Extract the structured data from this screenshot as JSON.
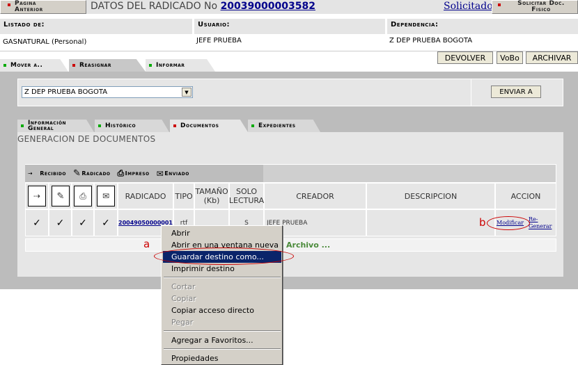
{
  "header": {
    "prev_page_line1": "Pagina",
    "prev_page_line2": "Anterior",
    "title_prefix": "DATOS DEL RADICADO No",
    "radicado_number": "20039000003582",
    "solicitados": "Solicitados",
    "solicitar_line1": "Solicitar Doc.",
    "solicitar_line2": "Fisico"
  },
  "info": {
    "listado_label": "Listado de:",
    "listado_value": "GASNATURAL (Personal)",
    "usuario_label": "Usuario:",
    "usuario_value": "JEFE PRUEBA",
    "dependencia_label": "Dependencia:",
    "dependencia_value": "Z DEP PRUEBA BOGOTA"
  },
  "actions": {
    "tab_mover": "Mover a..",
    "tab_reasignar": "Reasignar",
    "tab_informar": "Informar",
    "devolver": "DEVOLVER",
    "vobo": "VoBo",
    "archivar": "ARCHIVAR"
  },
  "reassign": {
    "selected": "Z DEP PRUEBA BOGOTA",
    "enviar": "ENVIAR A"
  },
  "tabs": {
    "info_line1": "Información",
    "info_line2": "General",
    "historico": "Histórico",
    "documentos": "Documentos",
    "expedientes": "Expedientes"
  },
  "section_title": "GENERACION DE DOCUMENTOS",
  "legend": {
    "recibido": "Recibido",
    "radicado": "Radicado",
    "impreso": "Impreso",
    "enviado": "Enviado"
  },
  "table": {
    "headers": {
      "radicado": "RADICADO",
      "tipo": "TIPO",
      "tamano_line1": "TAMAÑO",
      "tamano_line2": "(Kb)",
      "solo_line1": "SOLO",
      "solo_line2": "LECTURA",
      "creador": "CREADOR",
      "descripcion": "DESCRIPCION",
      "accion": "ACCION"
    },
    "row": {
      "checks": [
        "✓",
        "✓",
        "✓",
        "✓"
      ],
      "radicado": "20049050000001",
      "tipo": "rtf",
      "solo": "S",
      "creador": "JEFE PRUEBA",
      "modificar": "Modificar",
      "regenerar_line1": "Re-",
      "regenerar_line2": "Generar"
    },
    "archivo_link": "Archivo ..."
  },
  "annotations": {
    "a": "a",
    "b": "b",
    "color": "#cc0000"
  },
  "context_menu": {
    "items": [
      "Abrir",
      "Abrir en una ventana nueva",
      "Guardar destino como...",
      "Imprimir destino"
    ],
    "disabled": [
      "Cortar",
      "Copiar"
    ],
    "copy_shortcut": "Copiar acceso directo",
    "paste": "Pegar",
    "favorites": "Agregar a Favoritos...",
    "properties": "Propiedades"
  }
}
